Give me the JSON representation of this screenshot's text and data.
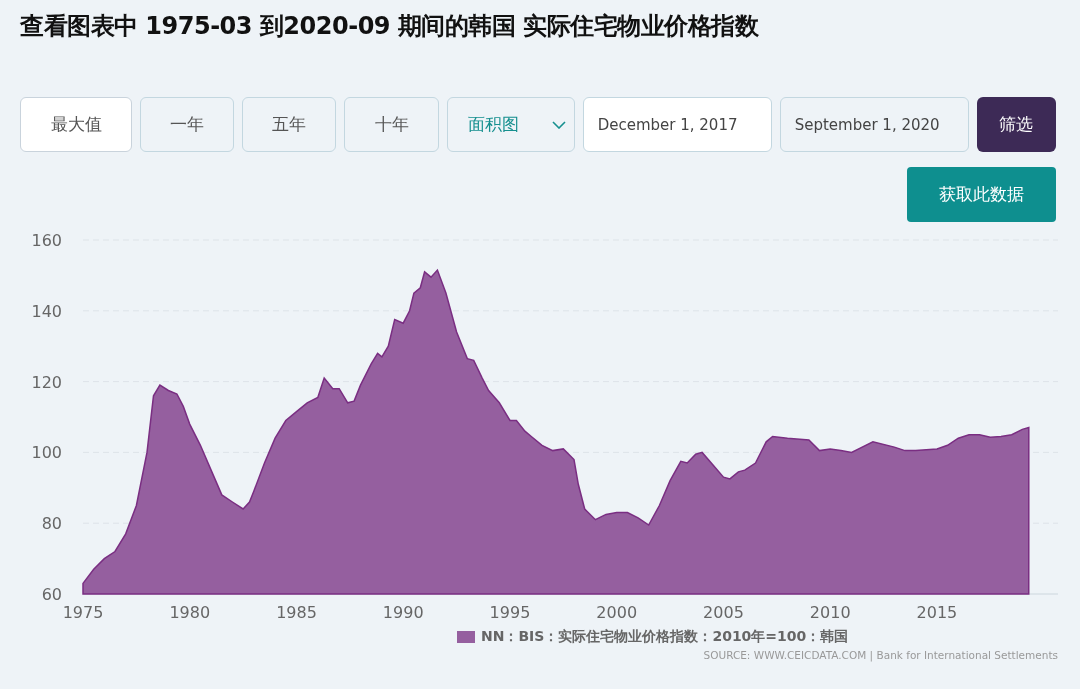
{
  "title": "查看图表中 1975-03 到2020-09 期间的韩国 实际住宅物业价格指数",
  "toolbar": {
    "range_buttons": [
      {
        "label": "最大值",
        "selected": true
      },
      {
        "label": "一年",
        "selected": false
      },
      {
        "label": "五年",
        "selected": false
      },
      {
        "label": "十年",
        "selected": false
      }
    ],
    "chart_type": {
      "value": "面积图"
    },
    "date_from": {
      "value": "December 1, 2017"
    },
    "date_to": {
      "value": "September 1, 2020"
    },
    "filter_button": "筛选"
  },
  "get_data_button": "获取此数据",
  "chart": {
    "chart_data": {
      "type": "area",
      "xlim": [
        1975,
        2020.67
      ],
      "grid": true,
      "ylim": [
        60,
        160
      ],
      "xticks": [
        1975,
        1980,
        1985,
        1990,
        1995,
        2000,
        2005,
        2010,
        2015
      ],
      "yticks": [
        60,
        80,
        100,
        120,
        140,
        160
      ],
      "x": [
        1975,
        1975.5,
        1976,
        1976.5,
        1977,
        1977.5,
        1978,
        1978.3,
        1978.6,
        1979,
        1979.4,
        1979.7,
        1980,
        1980.5,
        1981,
        1981.5,
        1982,
        1982.5,
        1982.8,
        1983,
        1983.5,
        1984,
        1984.5,
        1985,
        1985.5,
        1986,
        1986.3,
        1986.7,
        1987,
        1987.4,
        1987.7,
        1988,
        1988.5,
        1988.8,
        1989,
        1989.3,
        1989.6,
        1990,
        1990.3,
        1990.5,
        1990.8,
        1991,
        1991.3,
        1991.6,
        1992,
        1992.5,
        1993,
        1993.3,
        1993.7,
        1994,
        1994.5,
        1995,
        1995.3,
        1995.7,
        1996,
        1996.5,
        1997,
        1997.5,
        1998,
        1998.2,
        1998.5,
        1999,
        1999.5,
        2000,
        2000.5,
        2001,
        2001.5,
        2002,
        2002.5,
        2003,
        2003.3,
        2003.7,
        2004,
        2004.5,
        2005,
        2005.3,
        2005.7,
        2006,
        2006.5,
        2007,
        2007.3,
        2008,
        2009,
        2009.5,
        2010,
        2010.5,
        2011,
        2011.5,
        2012,
        2013,
        2013.5,
        2014,
        2015,
        2015.5,
        2016,
        2016.5,
        2017,
        2017.5,
        2018,
        2018.5,
        2019,
        2019.3
      ],
      "series": [
        {
          "name": "NN：BIS：实际住宅物业价格指数：2010年=100：韩国",
          "color": "#955f9f",
          "values": [
            63,
            67,
            70,
            72,
            77,
            85,
            100,
            116,
            119,
            117.5,
            116.5,
            113,
            108,
            102,
            95,
            88,
            86,
            84,
            86,
            89,
            97,
            104,
            109,
            111.5,
            114,
            115.5,
            121,
            118,
            118,
            114,
            114.5,
            119,
            125,
            128,
            127,
            130,
            137.5,
            136.5,
            140,
            145,
            146.5,
            151,
            149.5,
            151.5,
            145,
            134,
            126.5,
            126,
            121,
            117.5,
            114,
            109,
            109,
            106,
            104.5,
            102,
            100.5,
            101,
            98,
            91,
            84,
            81,
            82.5,
            83,
            83,
            81.5,
            79.5,
            85,
            92,
            97.5,
            97,
            99.5,
            100,
            96.5,
            93,
            92.5,
            94.5,
            95,
            97,
            103,
            104.5,
            104,
            103.5,
            100.5,
            101,
            100.5,
            100,
            101.5,
            103,
            101.5,
            100.5,
            100.5,
            101,
            102,
            104,
            105,
            105,
            104.3,
            104.5,
            105,
            106.5,
            107
          ]
        }
      ]
    }
  },
  "source": "SOURCE: WWW.CEICDATA.COM | Bank for International Settlements"
}
